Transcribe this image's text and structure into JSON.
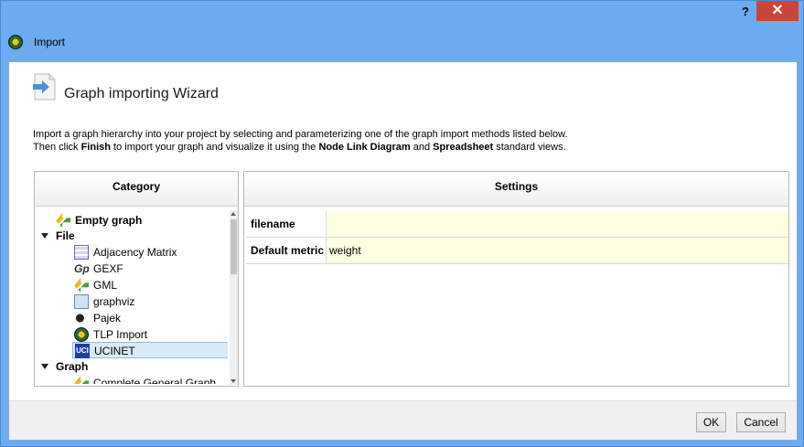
{
  "window": {
    "title": "Import",
    "help_label": "?",
    "close_label": "✕"
  },
  "wizard": {
    "title": "Graph importing Wizard",
    "intro": {
      "line1": "Import a graph hierarchy into your project by selecting and parameterizing one of the graph import methods listed below.",
      "line2_prefix": "Then click ",
      "line2_finish": "Finish",
      "line2_mid": " to import your graph and visualize it using the ",
      "line2_nld": "Node Link Diagram",
      "line2_and": " and ",
      "line2_sheet": "Spreadsheet",
      "line2_suffix": " standard views."
    }
  },
  "category": {
    "header": "Category",
    "items": [
      {
        "label": "Empty graph",
        "icon": "arrows-icon"
      },
      {
        "label": "File",
        "icon": "expand-arrow"
      },
      {
        "label": "Adjacency Matrix",
        "icon": "matrix-icon"
      },
      {
        "label": "GEXF",
        "icon": "gexf-icon"
      },
      {
        "label": "GML",
        "icon": "arrows-icon"
      },
      {
        "label": "graphviz",
        "icon": "graphviz-icon"
      },
      {
        "label": "Pajek",
        "icon": "pajek-icon"
      },
      {
        "label": "TLP Import",
        "icon": "tlp-icon"
      },
      {
        "label": "UCINET",
        "icon": "ucinet-icon"
      },
      {
        "label": "Graph",
        "icon": "expand-arrow"
      },
      {
        "label": "Complete General Graph",
        "icon": "arrows-icon"
      }
    ],
    "selected": "UCINET"
  },
  "settings": {
    "header": "Settings",
    "rows": [
      {
        "label": "filename",
        "value": ""
      },
      {
        "label": "Default metric",
        "value": "weight"
      }
    ]
  },
  "buttons": {
    "ok": "OK",
    "cancel": "Cancel"
  }
}
